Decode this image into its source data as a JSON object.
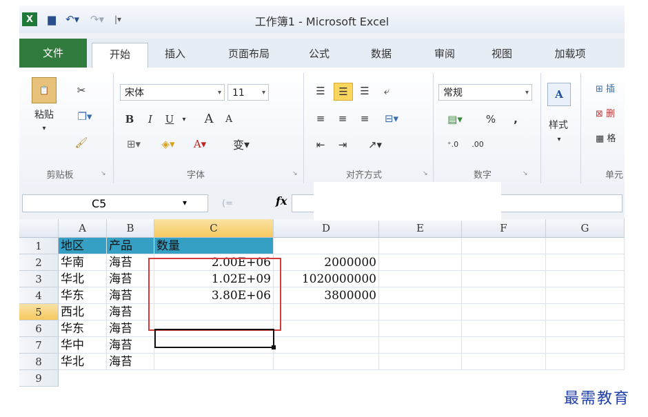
{
  "window": {
    "title": "工作簿1 - Microsoft Excel"
  },
  "quick_access": {
    "excel_icon": "excel-icon",
    "save_icon": "save-icon",
    "undo_icon": "undo-icon",
    "redo_icon": "redo-icon",
    "customize_icon": "customize-icon"
  },
  "tabs": [
    "文件",
    "开始",
    "插入",
    "页面布局",
    "公式",
    "数据",
    "审阅",
    "视图",
    "加载项"
  ],
  "ribbon": {
    "clipboard": {
      "paste_label": "粘贴",
      "group_label": "剪贴板"
    },
    "font": {
      "font_name": "宋体",
      "font_size": "11",
      "group_label": "字体",
      "bold": "B",
      "italic": "I",
      "underline": "U",
      "grow": "A",
      "shrink": "A",
      "phonetic": "变"
    },
    "alignment": {
      "group_label": "对齐方式"
    },
    "number": {
      "format": "常规",
      "percent": "%",
      "comma": ",",
      "group_label": "数字"
    },
    "styles": {
      "label": "样式"
    },
    "cells": {
      "group_label": "单元"
    }
  },
  "formula_bar": {
    "name_box": "C5",
    "fx": "fx"
  },
  "grid": {
    "columns": [
      "A",
      "B",
      "C",
      "D",
      "E",
      "F",
      "G"
    ],
    "rows": [
      "1",
      "2",
      "3",
      "4",
      "5",
      "6",
      "7",
      "8",
      "9"
    ],
    "cells": [
      [
        "地区",
        "产品",
        "数量",
        "",
        "",
        "",
        ""
      ],
      [
        "华南",
        "海苔",
        "2.00E+06",
        "2000000",
        "",
        "",
        ""
      ],
      [
        "华北",
        "海苔",
        "1.02E+09",
        "1020000000",
        "",
        "",
        ""
      ],
      [
        "华东",
        "海苔",
        "3.80E+06",
        "3800000",
        "",
        "",
        ""
      ],
      [
        "西北",
        "海苔",
        "",
        "",
        "",
        "",
        ""
      ],
      [
        "华东",
        "海苔",
        "",
        "",
        "",
        "",
        ""
      ],
      [
        "华中",
        "海苔",
        "",
        "",
        "",
        "",
        ""
      ],
      [
        "华北",
        "海苔",
        "",
        "",
        "",
        "",
        ""
      ],
      [
        "",
        "",
        "",
        "",
        "",
        "",
        ""
      ]
    ],
    "selected_cell": "C5"
  },
  "watermark": "最需教育",
  "colors": {
    "file_tab": "#2f7a3c",
    "header_fill": "#35a0c4",
    "highlight_box": "#d33a3a",
    "selected_header": "#f5c860"
  }
}
